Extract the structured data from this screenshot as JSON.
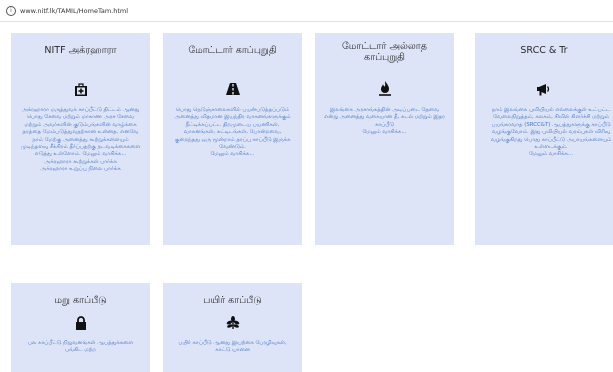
{
  "address_bar": {
    "url": "www.nitf.lk/TAMIL/HomeTam.html"
  },
  "cards": [
    {
      "title": "NITF அக்ரஹாரா",
      "description": "அக்ரஹாரா மருத்துவக் காப்பீட்டு திட்டம் ஆனது பொது சேவை மற்றும் மாகாண அரச சேவை மற்றும் அவர்களின் குடும்பங்களின் வாழ்க்கை தரத்தை மேம்படுத்துவதற்கான உன்னத. எனவே நாம் மேற்கு அனைத்து கூற்றுக்களையும் முடிந்தளவு சீக்கிரம் தீர்ப்பதற்கு நடவடிக்கைகளை எடுத்து உள்ளோம். மேலும் வாசிக்க...\nஅக்ரஹாரா கூற்றுக்கள் பார்க்க\nஅக்ரஹாரா உறுப்பு நிலை பார்க்க"
    },
    {
      "title": "மோட்டார் காப்புறுதி",
      "description": "பொது நெடுஞ்சாலைகளில் பயன்படுத்தப்படும் அனைத்து விதமான இயந்திர வாகனங்களுக்கும் நீட்டிக்கப்பட்ட திறமுடைய பயணிகள், வாகனங்கள், கட்டிடங்கள், போன்றவை, குறைந்தது ஒரு மூன்றாம் தரப்பு காப்பீடு இருக்க வேண்டும்.\nமேலும் வாசிக்க..."
    },
    {
      "title": "மோட்டார் அல்லாத காப்புறுதி",
      "description": "இலங்கை அரசாங்கத்தின் அடிப்படை தேவை என்று அனைத்து வகையான தீ, கடல் மற்றும் இதர காப்பீடு\nமேலும் வாசிக்க..."
    },
    {
      "title": "SRCC & Tr",
      "description": "நாம் இலங்கை புவியியல் எல்லைக்குள் உட்பட்ட வேலைநிறுத்தம், கலகம், சிவில் கிளர்ச்சி மற்றும் பயங்கரவாத (SRCC&T) ஆபத்துகளுக்கு காப்பீடு வழங்குவோம். இது புவியியல் வரம்புகள் விரிவு வழங்குகிறது பொது காப்பீட்டு அபாயங்களையும் உள்ளடக்கும்.\nமேலும் வாசிக்க..."
    },
    {
      "title": "மறு காப்பீடு",
      "description": "பல காப்பீட்டு நிறுவனங்கள் ஆபத்துக்களை பங்கிட மற்ற"
    },
    {
      "title": "பயிர் காப்பீடு",
      "description": "பயிர் காப்பீடு ஆனது இயற்கை பேரழிவுகள், காட்டு யானை"
    }
  ],
  "icons": {
    "card0": "medkit-icon",
    "card1": "road-icon",
    "card2": "fire-icon",
    "card3": "bullhorn-icon",
    "card4": "lock-icon",
    "card5": "leaf-icon"
  },
  "colors": {
    "card_background": "#dde4f7",
    "description_text": "#4b78c2",
    "title_text": "#2a2a2a"
  }
}
